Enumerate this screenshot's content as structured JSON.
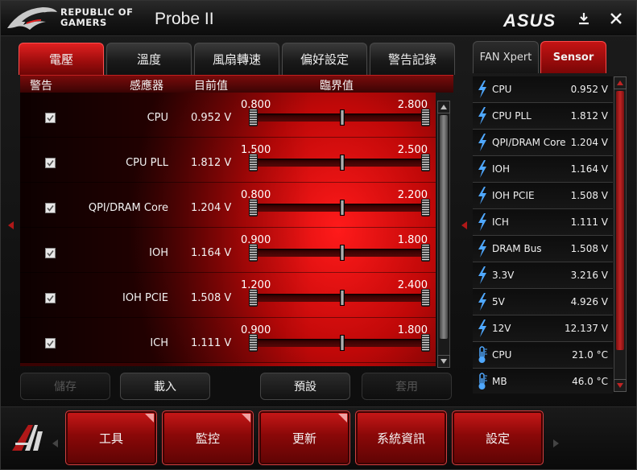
{
  "window": {
    "brand_line1": "REPUBLIC OF",
    "brand_line2": "GAMERS",
    "app_title": "Probe II",
    "vendor_logo": "ASUS",
    "minimize_icon": "download-minimize-icon",
    "close_icon": "close-icon"
  },
  "tabs": [
    {
      "label": "電壓",
      "active": true
    },
    {
      "label": "溫度",
      "active": false
    },
    {
      "label": "風扇轉速",
      "active": false
    },
    {
      "label": "偏好設定",
      "active": false
    },
    {
      "label": "警告記錄",
      "active": false
    }
  ],
  "columns": {
    "alert": "警告",
    "sensor": "感應器",
    "current": "目前值",
    "threshold": "臨界值"
  },
  "voltage_rows": [
    {
      "name": "CPU",
      "value": "0.952 V",
      "min": "0.800",
      "max": "2.800",
      "checked": true
    },
    {
      "name": "CPU PLL",
      "value": "1.812 V",
      "min": "1.500",
      "max": "2.500",
      "checked": true
    },
    {
      "name": "QPI/DRAM Core",
      "value": "1.204 V",
      "min": "0.800",
      "max": "2.200",
      "checked": true
    },
    {
      "name": "IOH",
      "value": "1.164 V",
      "min": "0.900",
      "max": "1.800",
      "checked": true
    },
    {
      "name": "IOH PCIE",
      "value": "1.508 V",
      "min": "1.200",
      "max": "2.400",
      "checked": true
    },
    {
      "name": "ICH",
      "value": "1.111 V",
      "min": "0.900",
      "max": "1.800",
      "checked": true
    }
  ],
  "actions": {
    "save": "儲存",
    "load": "載入",
    "default": "預設",
    "apply": "套用"
  },
  "right_tabs": [
    {
      "label": "FAN Xpert",
      "active": false
    },
    {
      "label": "Sensor",
      "active": true
    }
  ],
  "sensors": [
    {
      "icon": "lightning-icon",
      "name": "CPU",
      "value": "0.952  V"
    },
    {
      "icon": "lightning-icon",
      "name": "CPU PLL",
      "value": "1.812  V"
    },
    {
      "icon": "lightning-icon",
      "name": "QPI/DRAM Core",
      "value": "1.204  V"
    },
    {
      "icon": "lightning-icon",
      "name": "IOH",
      "value": "1.164  V"
    },
    {
      "icon": "lightning-icon",
      "name": "IOH PCIE",
      "value": "1.508  V"
    },
    {
      "icon": "lightning-icon",
      "name": "ICH",
      "value": "1.111  V"
    },
    {
      "icon": "lightning-icon",
      "name": "DRAM Bus",
      "value": "1.508  V"
    },
    {
      "icon": "lightning-icon",
      "name": "3.3V",
      "value": "3.216  V"
    },
    {
      "icon": "lightning-icon",
      "name": "5V",
      "value": "4.926  V"
    },
    {
      "icon": "lightning-icon",
      "name": "12V",
      "value": "12.137  V"
    },
    {
      "icon": "thermometer-icon",
      "name": "CPU",
      "value": "21.0 °C"
    },
    {
      "icon": "thermometer-icon",
      "name": "MB",
      "value": "46.0 °C"
    }
  ],
  "bottom_buttons": [
    {
      "label": "工具",
      "corner": true
    },
    {
      "label": "監控",
      "corner": true
    },
    {
      "label": "更新",
      "corner": true
    },
    {
      "label": "系統資訊",
      "corner": false
    },
    {
      "label": "設定",
      "corner": false
    }
  ],
  "colors": {
    "accent_red": "#e02020",
    "dark_bg": "#0a0a0a"
  }
}
